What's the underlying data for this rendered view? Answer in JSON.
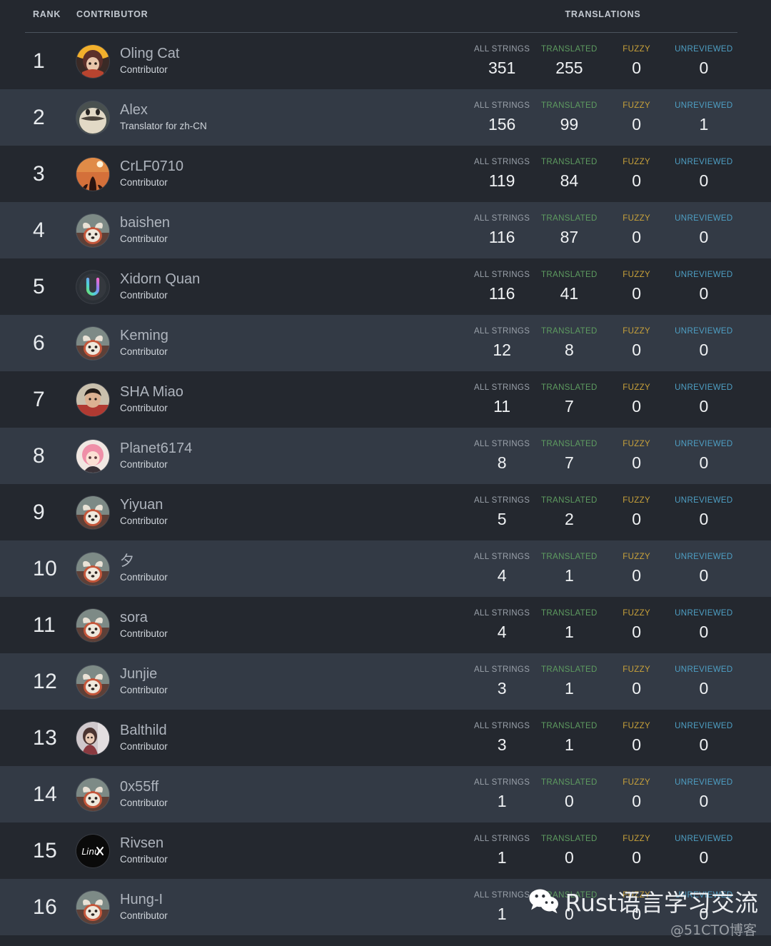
{
  "header": {
    "rank_label": "RANK",
    "contributor_label": "CONTRIBUTOR",
    "translations_label": "TRANSLATIONS"
  },
  "stat_labels": {
    "all_strings": "ALL STRINGS",
    "translated": "TRANSLATED",
    "fuzzy": "FUZZY",
    "unreviewed": "UNREVIEWED"
  },
  "colors": {
    "page_background": "#24282f",
    "row_alt_background": "#333a45",
    "all_strings": "#9aa1aa",
    "translated": "#5e9c60",
    "fuzzy": "#c8a13a",
    "unreviewed": "#4e9fc4",
    "rule": "#4c535d"
  },
  "rows": [
    {
      "rank": "1",
      "name": "Oling Cat",
      "role": "Contributor",
      "all_strings": "351",
      "translated": "255",
      "fuzzy": "0",
      "unreviewed": "0",
      "avatar": "anime-girl-orange-avatar"
    },
    {
      "rank": "2",
      "name": "Alex",
      "role": "Translator for zh-CN",
      "all_strings": "156",
      "translated": "99",
      "fuzzy": "0",
      "unreviewed": "1",
      "avatar": "beige-creature-avatar"
    },
    {
      "rank": "3",
      "name": "CrLF0710",
      "role": "Contributor",
      "all_strings": "119",
      "translated": "84",
      "fuzzy": "0",
      "unreviewed": "0",
      "avatar": "orange-silhouette-avatar"
    },
    {
      "rank": "4",
      "name": "baishen",
      "role": "Contributor",
      "all_strings": "116",
      "translated": "87",
      "fuzzy": "0",
      "unreviewed": "0",
      "avatar": "red-panda-avatar"
    },
    {
      "rank": "5",
      "name": "Xidorn Quan",
      "role": "Contributor",
      "all_strings": "116",
      "translated": "41",
      "fuzzy": "0",
      "unreviewed": "0",
      "avatar": "gradient-u-logo-avatar"
    },
    {
      "rank": "6",
      "name": "Keming",
      "role": "Contributor",
      "all_strings": "12",
      "translated": "8",
      "fuzzy": "0",
      "unreviewed": "0",
      "avatar": "red-panda-avatar"
    },
    {
      "rank": "7",
      "name": "SHA Miao",
      "role": "Contributor",
      "all_strings": "11",
      "translated": "7",
      "fuzzy": "0",
      "unreviewed": "0",
      "avatar": "person-photo-avatar"
    },
    {
      "rank": "8",
      "name": "Planet6174",
      "role": "Contributor",
      "all_strings": "8",
      "translated": "7",
      "fuzzy": "0",
      "unreviewed": "0",
      "avatar": "pink-anime-avatar"
    },
    {
      "rank": "9",
      "name": "Yiyuan",
      "role": "Contributor",
      "all_strings": "5",
      "translated": "2",
      "fuzzy": "0",
      "unreviewed": "0",
      "avatar": "red-panda-avatar"
    },
    {
      "rank": "10",
      "name": "夕",
      "role": "Contributor",
      "all_strings": "4",
      "translated": "1",
      "fuzzy": "0",
      "unreviewed": "0",
      "avatar": "red-panda-avatar"
    },
    {
      "rank": "11",
      "name": "sora",
      "role": "Contributor",
      "all_strings": "4",
      "translated": "1",
      "fuzzy": "0",
      "unreviewed": "0",
      "avatar": "red-panda-avatar"
    },
    {
      "rank": "12",
      "name": "Junjie",
      "role": "Contributor",
      "all_strings": "3",
      "translated": "1",
      "fuzzy": "0",
      "unreviewed": "0",
      "avatar": "red-panda-avatar"
    },
    {
      "rank": "13",
      "name": "Balthild",
      "role": "Contributor",
      "all_strings": "3",
      "translated": "1",
      "fuzzy": "0",
      "unreviewed": "0",
      "avatar": "anime-photo-avatar"
    },
    {
      "rank": "14",
      "name": "0x55ff",
      "role": "Contributor",
      "all_strings": "1",
      "translated": "0",
      "fuzzy": "0",
      "unreviewed": "0",
      "avatar": "red-panda-avatar"
    },
    {
      "rank": "15",
      "name": "Rivsen",
      "role": "Contributor",
      "all_strings": "1",
      "translated": "0",
      "fuzzy": "0",
      "unreviewed": "0",
      "avatar": "linux-logo-avatar"
    },
    {
      "rank": "16",
      "name": "Hung-I",
      "role": "Contributor",
      "all_strings": "1",
      "translated": "0",
      "fuzzy": "0",
      "unreviewed": "0",
      "avatar": "red-panda-avatar"
    }
  ],
  "watermark": {
    "title": "Rust语言学习交流",
    "subtitle": "@51CTO博客",
    "icon": "wechat-icon"
  }
}
